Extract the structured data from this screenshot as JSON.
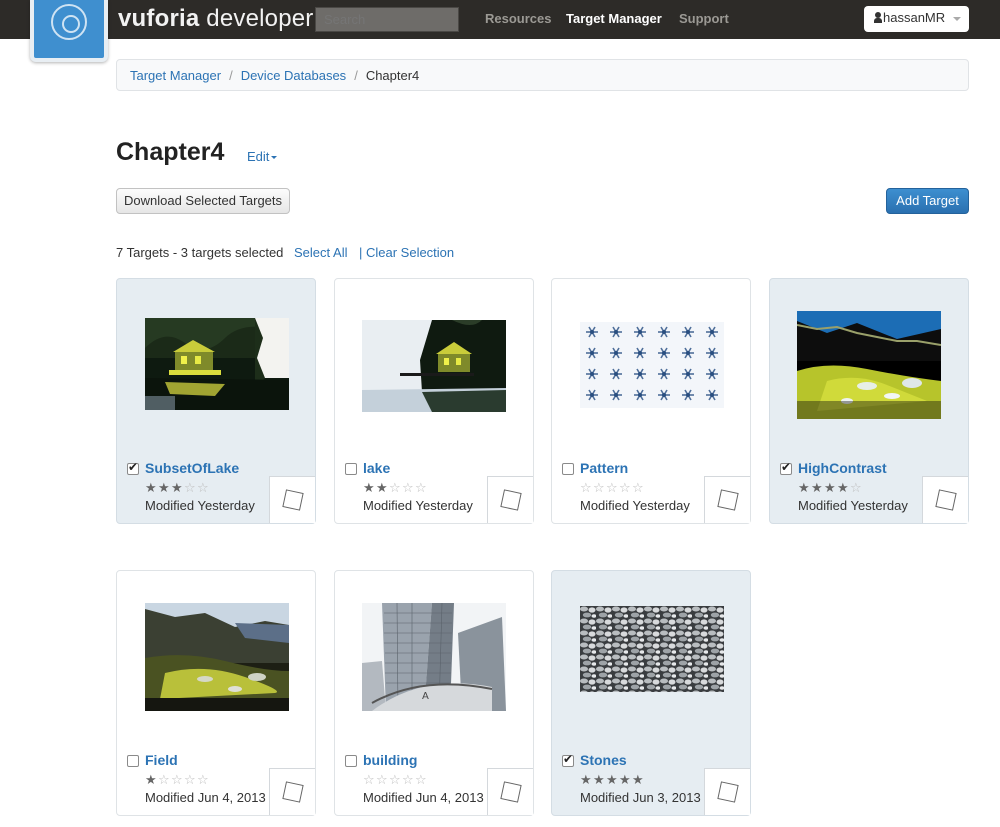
{
  "nav": {
    "brand_bold": "vuforia",
    "brand_rest": " developer",
    "search_placeholder": "Search",
    "links": [
      "Resources",
      "Target Manager",
      "Support"
    ],
    "active_link": "Target Manager",
    "user": "hassanMR"
  },
  "breadcrumb": {
    "items": [
      "Target Manager",
      "Device Databases"
    ],
    "current": "Chapter4"
  },
  "page": {
    "title": "Chapter4",
    "edit_label": "Edit",
    "download_label": "Download Selected Targets",
    "add_label": "Add Target",
    "selection_info": "7 Targets - 3 targets selected",
    "select_all": "Select All",
    "clear_selection": "| Clear Selection"
  },
  "targets": [
    {
      "name": "SubsetOfLake",
      "rating": 3,
      "modified": "Modified Yesterday",
      "selected": true,
      "image": "lake-house-crop"
    },
    {
      "name": "lake",
      "rating": 2,
      "modified": "Modified Yesterday",
      "selected": false,
      "image": "lake-house"
    },
    {
      "name": "Pattern",
      "rating": 0,
      "modified": "Modified Yesterday",
      "selected": false,
      "image": "snowflake-pattern"
    },
    {
      "name": "HighContrast",
      "rating": 4,
      "modified": "Modified Yesterday",
      "selected": true,
      "image": "mountain-field-high-contrast"
    },
    {
      "name": "Field",
      "rating": 1,
      "modified": "Modified Jun 4, 2013",
      "selected": false,
      "image": "mountain-field"
    },
    {
      "name": "building",
      "rating": 0,
      "modified": "Modified Jun 4, 2013",
      "selected": false,
      "image": "tall-building"
    },
    {
      "name": "Stones",
      "rating": 5,
      "modified": "Modified Jun 3, 2013",
      "selected": true,
      "image": "gravel-stones"
    }
  ],
  "colors": {
    "navbar": "#2d2b28",
    "link": "#2c73b4",
    "primary_button": "#2f7ac0",
    "selected_card": "#e6edf2"
  }
}
